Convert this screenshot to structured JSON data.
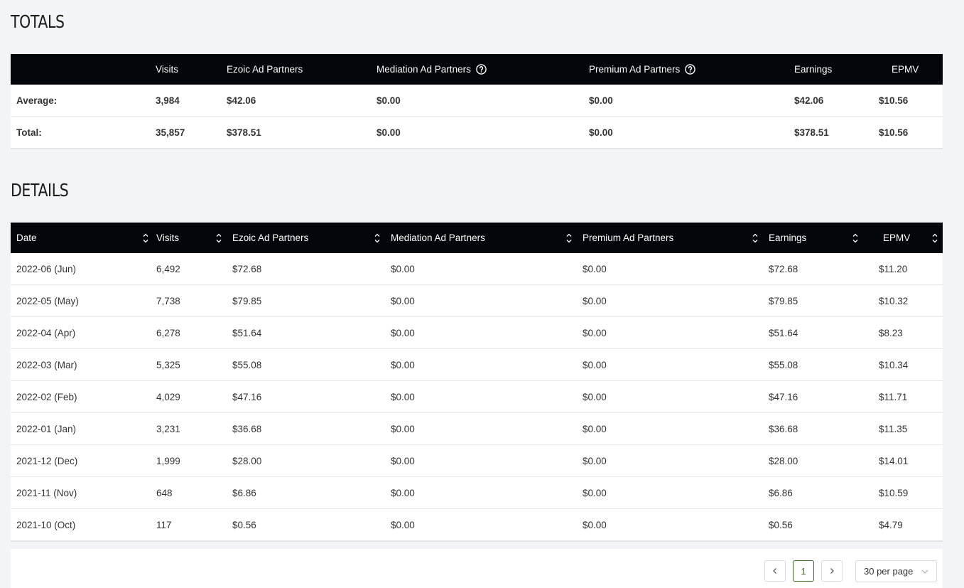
{
  "totals": {
    "title": "TOTALS",
    "headers": [
      "",
      "Visits",
      "Ezoic Ad Partners",
      "Mediation Ad Partners",
      "Premium Ad Partners",
      "Earnings",
      "EPMV"
    ],
    "help_icon_columns": [
      3,
      4
    ],
    "rows": [
      [
        "Average:",
        "3,984",
        "$42.06",
        "$0.00",
        "$0.00",
        "$42.06",
        "$10.56"
      ],
      [
        "Total:",
        "35,857",
        "$378.51",
        "$0.00",
        "$0.00",
        "$378.51",
        "$10.56"
      ]
    ]
  },
  "details": {
    "title": "DETAILS",
    "headers": [
      "Date",
      "Visits",
      "Ezoic Ad Partners",
      "Mediation Ad Partners",
      "Premium Ad Partners",
      "Earnings",
      "EPMV"
    ],
    "rows": [
      [
        "2022-06 (Jun)",
        "6,492",
        "$72.68",
        "$0.00",
        "$0.00",
        "$72.68",
        "$11.20"
      ],
      [
        "2022-05 (May)",
        "7,738",
        "$79.85",
        "$0.00",
        "$0.00",
        "$79.85",
        "$10.32"
      ],
      [
        "2022-04 (Apr)",
        "6,278",
        "$51.64",
        "$0.00",
        "$0.00",
        "$51.64",
        "$8.23"
      ],
      [
        "2022-03 (Mar)",
        "5,325",
        "$55.08",
        "$0.00",
        "$0.00",
        "$55.08",
        "$10.34"
      ],
      [
        "2022-02 (Feb)",
        "4,029",
        "$47.16",
        "$0.00",
        "$0.00",
        "$47.16",
        "$11.71"
      ],
      [
        "2022-01 (Jan)",
        "3,231",
        "$36.68",
        "$0.00",
        "$0.00",
        "$36.68",
        "$11.35"
      ],
      [
        "2021-12 (Dec)",
        "1,999",
        "$28.00",
        "$0.00",
        "$0.00",
        "$28.00",
        "$14.01"
      ],
      [
        "2021-11 (Nov)",
        "648",
        "$6.86",
        "$0.00",
        "$0.00",
        "$6.86",
        "$10.59"
      ],
      [
        "2021-10 (Oct)",
        "117",
        "$0.56",
        "$0.00",
        "$0.00",
        "$0.56",
        "$4.79"
      ]
    ]
  },
  "pagination": {
    "current_page": "1",
    "page_size": "30 per page",
    "prev_icon": "chevron-left-icon",
    "next_icon": "chevron-right-icon"
  },
  "colors": {
    "header_bg": "#020509",
    "page_bg": "#f3f4f8",
    "active_page": "#3c6e1f"
  }
}
